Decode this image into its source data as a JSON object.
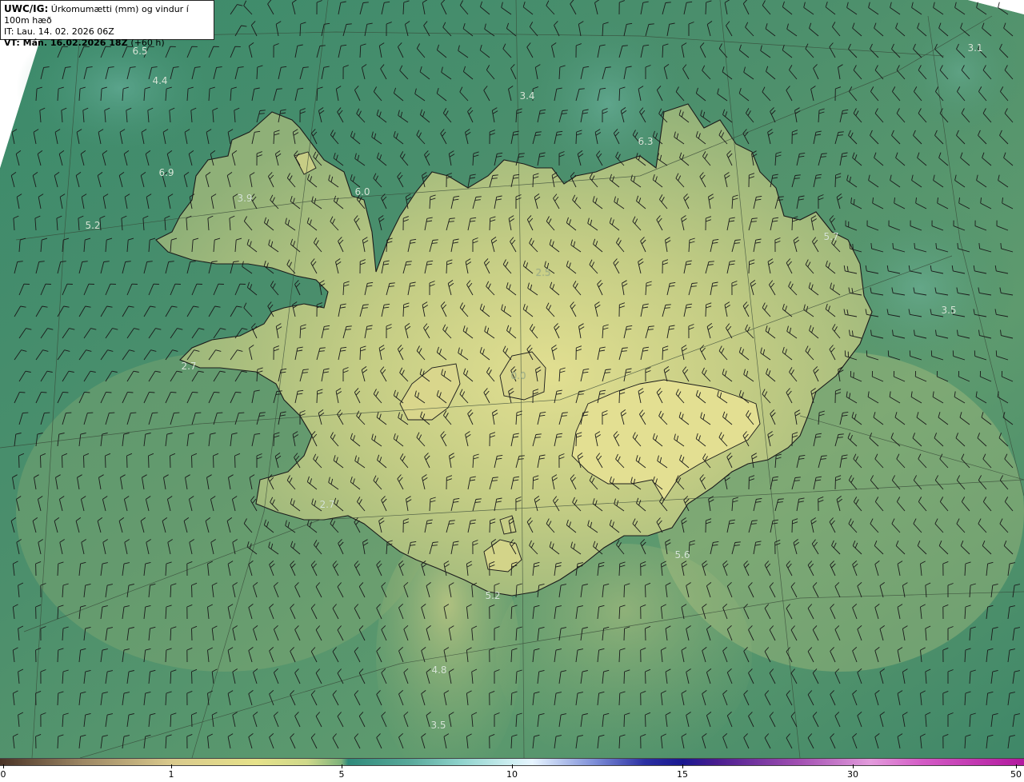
{
  "title": {
    "product": "UWC/IG:",
    "description": "Úrkomumætti (mm) og vindur í 100m hæð",
    "issue_time": "IT: Lau. 14. 02. 2026 06Z",
    "valid_time": "VT: Mán. 16.02.2026 18Z",
    "lead": "(+60 h)"
  },
  "value_labels": [
    {
      "text": "6.5"
    },
    {
      "text": "4.4"
    },
    {
      "text": "6.9"
    },
    {
      "text": "3.9"
    },
    {
      "text": "6.0"
    },
    {
      "text": "5.2"
    },
    {
      "text": "3.4"
    },
    {
      "text": "6.3"
    },
    {
      "text": "3.1"
    },
    {
      "text": "5.7"
    },
    {
      "text": "2.5"
    },
    {
      "text": "3.5"
    },
    {
      "text": "2.7"
    },
    {
      "text": "0.0"
    },
    {
      "text": "2.7"
    },
    {
      "text": "5.6"
    },
    {
      "text": "5.2"
    },
    {
      "text": "4.8"
    },
    {
      "text": "3.5"
    }
  ],
  "colorbar": {
    "ticks": [
      "0",
      "1",
      "5",
      "10",
      "15",
      "30",
      "50"
    ],
    "colors": [
      "#4a3326",
      "#d9c98c",
      "#e6e28a",
      "#2f8a7a",
      "#cfeff2",
      "#1a1890",
      "#b2189e"
    ]
  },
  "palette": {
    "sea": "#3f8a6c",
    "land_low": "#7fa66e",
    "land_high": "#dcd98e",
    "barb": "#1a1a1a",
    "graticule": "#3a4a3a"
  }
}
